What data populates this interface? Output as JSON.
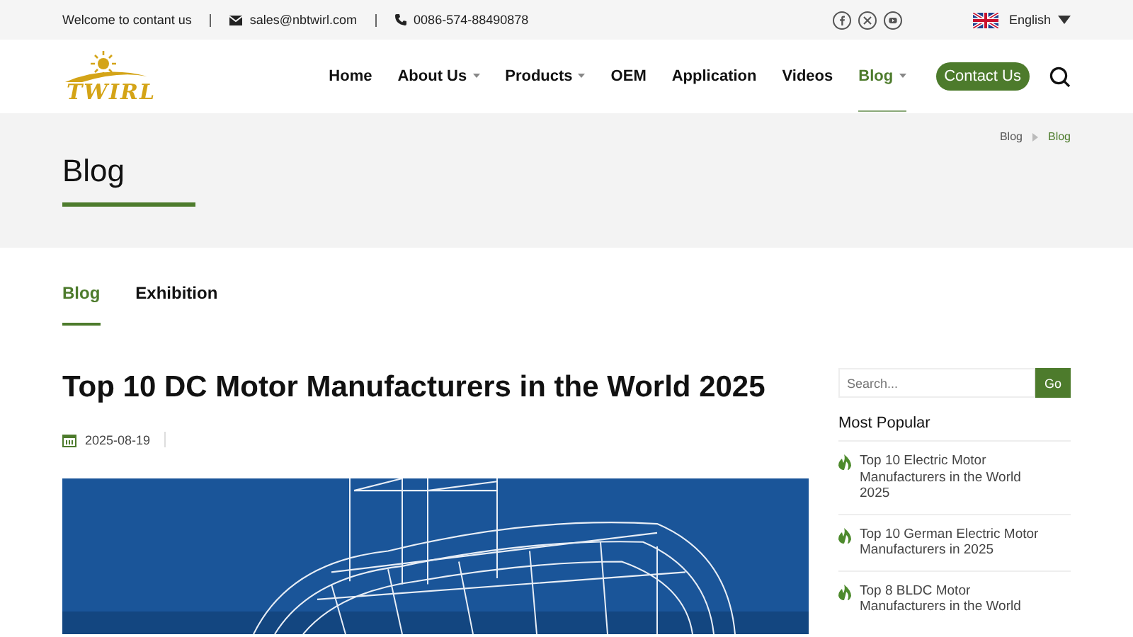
{
  "logo": "TWIRL",
  "topbar": {
    "welcome": "Welcome to contant us",
    "email": "sales@nbtwirl.com",
    "phone": "0086-574-88490878",
    "language": "English"
  },
  "nav": {
    "items": [
      {
        "label": "Home",
        "dropdown": false,
        "selected": false
      },
      {
        "label": "About Us",
        "dropdown": true,
        "selected": false
      },
      {
        "label": "Products",
        "dropdown": true,
        "selected": false
      },
      {
        "label": "OEM",
        "dropdown": false,
        "selected": false
      },
      {
        "label": "Application",
        "dropdown": false,
        "selected": false
      },
      {
        "label": "Videos",
        "dropdown": false,
        "selected": false
      },
      {
        "label": "Blog",
        "dropdown": true,
        "selected": true
      }
    ],
    "cta": "Contact Us"
  },
  "banner": {
    "title": "Blog",
    "breadcrumb": [
      "Blog",
      "Blog"
    ]
  },
  "tabs": [
    {
      "label": "Blog",
      "selected": true
    },
    {
      "label": "Exhibition",
      "selected": false
    }
  ],
  "article": {
    "title": "Top 10 DC Motor Manufacturers in the World 2025",
    "date": "2025-08-19"
  },
  "sidebar": {
    "search": {
      "placeholder": "Search...",
      "button": "Go"
    },
    "heading": "Most Popular",
    "items": [
      "Top 10 Electric Motor Manufacturers in the World 2025",
      "Top 10 German Electric Motor Manufacturers in 2025",
      "Top 8 BLDC Motor Manufacturers in the World"
    ]
  }
}
